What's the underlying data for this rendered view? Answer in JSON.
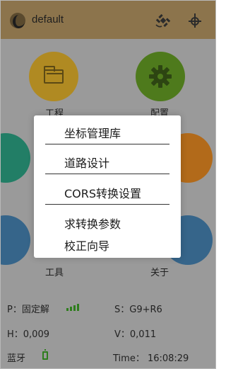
{
  "header": {
    "title": "default",
    "satellite_icon": "satellite-icon",
    "target_icon": "target-icon"
  },
  "tiles": [
    {
      "label": "工程",
      "icon": "folder-icon",
      "color": "#b08a22"
    },
    {
      "label": "配置",
      "icon": "gear-icon",
      "color": "#4e7a1c"
    },
    {
      "label": "工具",
      "icon": "tools-icon",
      "color": "#36658a"
    },
    {
      "label": "关于",
      "icon": "about-icon",
      "color": "#36658a"
    }
  ],
  "dialog": {
    "items": [
      {
        "label": "坐标管理库"
      },
      {
        "label": "道路设计"
      },
      {
        "label": "CORS转换设置"
      },
      {
        "label": "求转换参数"
      },
      {
        "label": "校正向导"
      }
    ]
  },
  "status": {
    "position": "P：固定解",
    "satellites": "S：G9+R6",
    "h_error": "H：0,009",
    "v_error": "V：0,011",
    "bluetooth": "蓝牙",
    "time": "Time： 16:08:29"
  },
  "colors": {
    "header": "#8c744c",
    "signal": "#2e7d1d"
  }
}
